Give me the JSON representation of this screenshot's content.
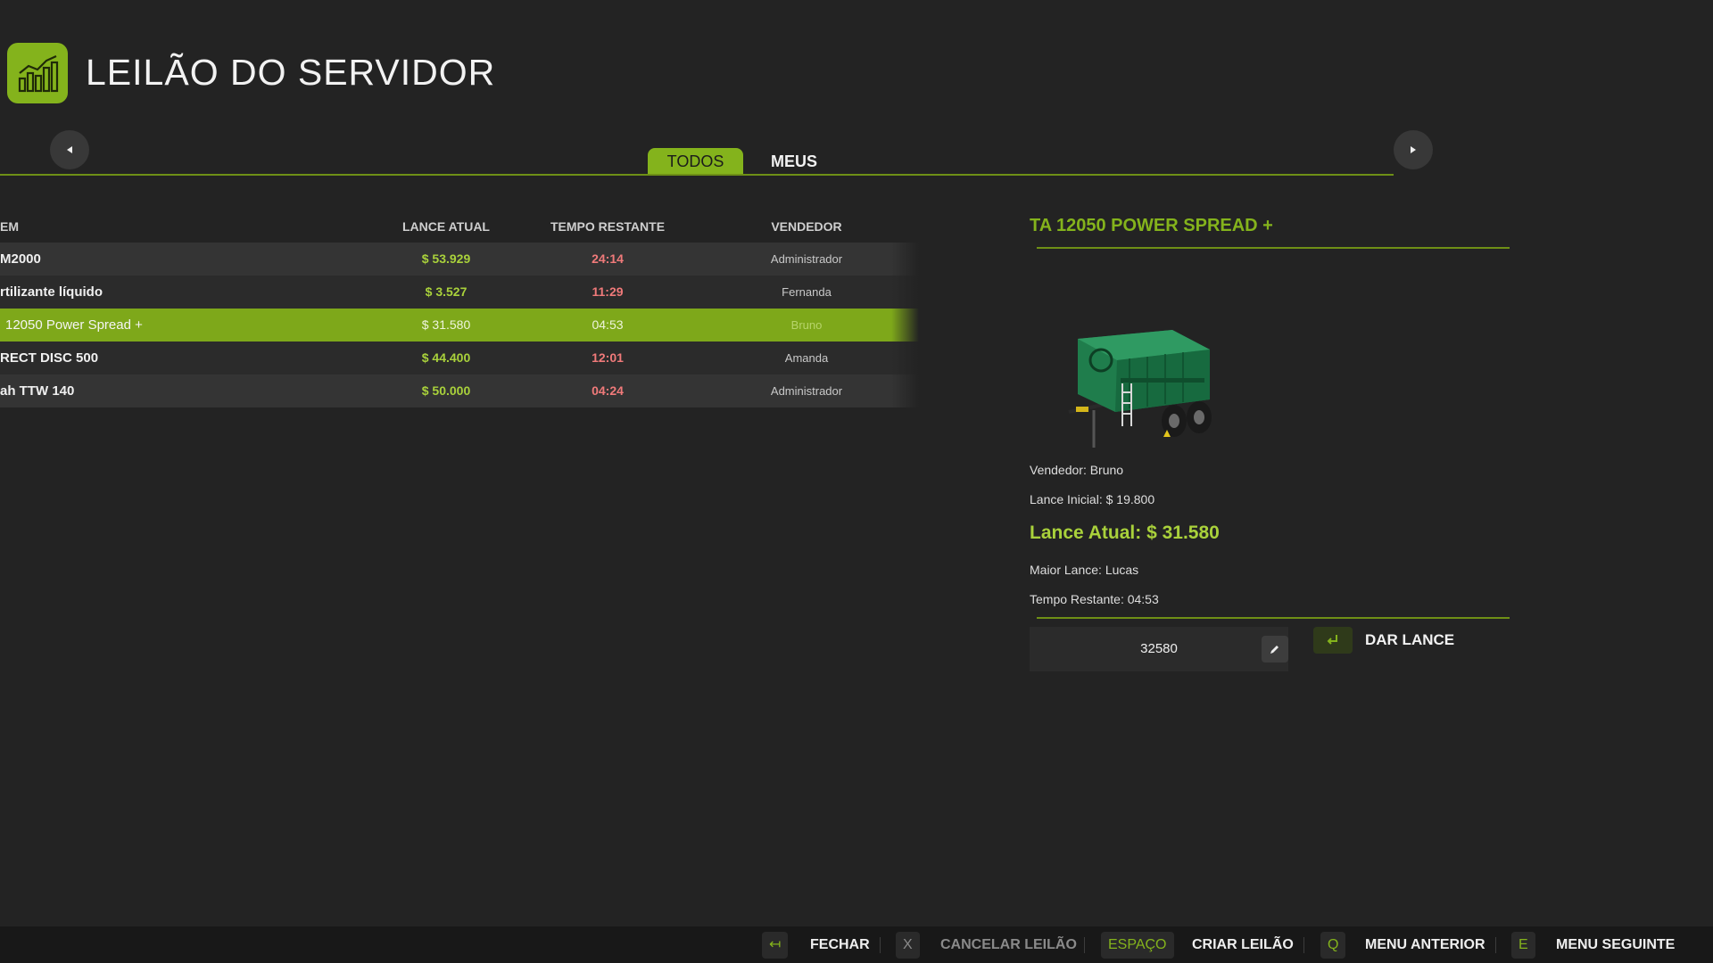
{
  "header": {
    "title": "LEILÃO DO SERVIDOR",
    "icon": "bar-chart-icon"
  },
  "tabs": [
    {
      "label": "TODOS",
      "active": true
    },
    {
      "label": "MEUS",
      "active": false
    }
  ],
  "table": {
    "columns": {
      "item": "EM",
      "price": "LANCE ATUAL",
      "time": "TEMPO RESTANTE",
      "seller": "VENDEDOR"
    },
    "rows": [
      {
        "name": "M2000",
        "price": "$ 53.929",
        "time": "24:14",
        "seller": "Administrador"
      },
      {
        "name": "rtilizante líquido",
        "price": "$ 3.527",
        "time": "11:29",
        "seller": "Fernanda"
      },
      {
        "name": "12050 Power Spread +",
        "price": "$ 31.580",
        "time": "04:53",
        "seller": "Bruno",
        "selected": true
      },
      {
        "name": "RECT DISC 500",
        "price": "$ 44.400",
        "time": "12:01",
        "seller": "Amanda"
      },
      {
        "name": "ah TTW 140",
        "price": "$ 50.000",
        "time": "04:24",
        "seller": "Administrador"
      }
    ]
  },
  "detail": {
    "title": "TA 12050 POWER SPREAD +",
    "seller": "Vendedor: Bruno",
    "initial_bid": "Lance Inicial: $ 19.800",
    "current_bid": "Lance Atual: $ 31.580",
    "top_bidder": "Maior Lance: Lucas",
    "time_left": "Tempo Restante: 04:53",
    "bid_value": "32580",
    "bid_button": "DAR LANCE"
  },
  "footer": [
    {
      "key": "↤",
      "label": "FECHAR"
    },
    {
      "key": "X",
      "label": "CANCELAR LEILÃO"
    },
    {
      "key": "ESPAÇO",
      "label": "CRIAR LEILÃO"
    },
    {
      "key": "Q",
      "label": "MENU ANTERIOR"
    },
    {
      "key": "E",
      "label": "MENU SEGUINTE"
    }
  ],
  "colors": {
    "accent": "#84b31c",
    "background": "#232323",
    "timer": "#f07a7a"
  }
}
